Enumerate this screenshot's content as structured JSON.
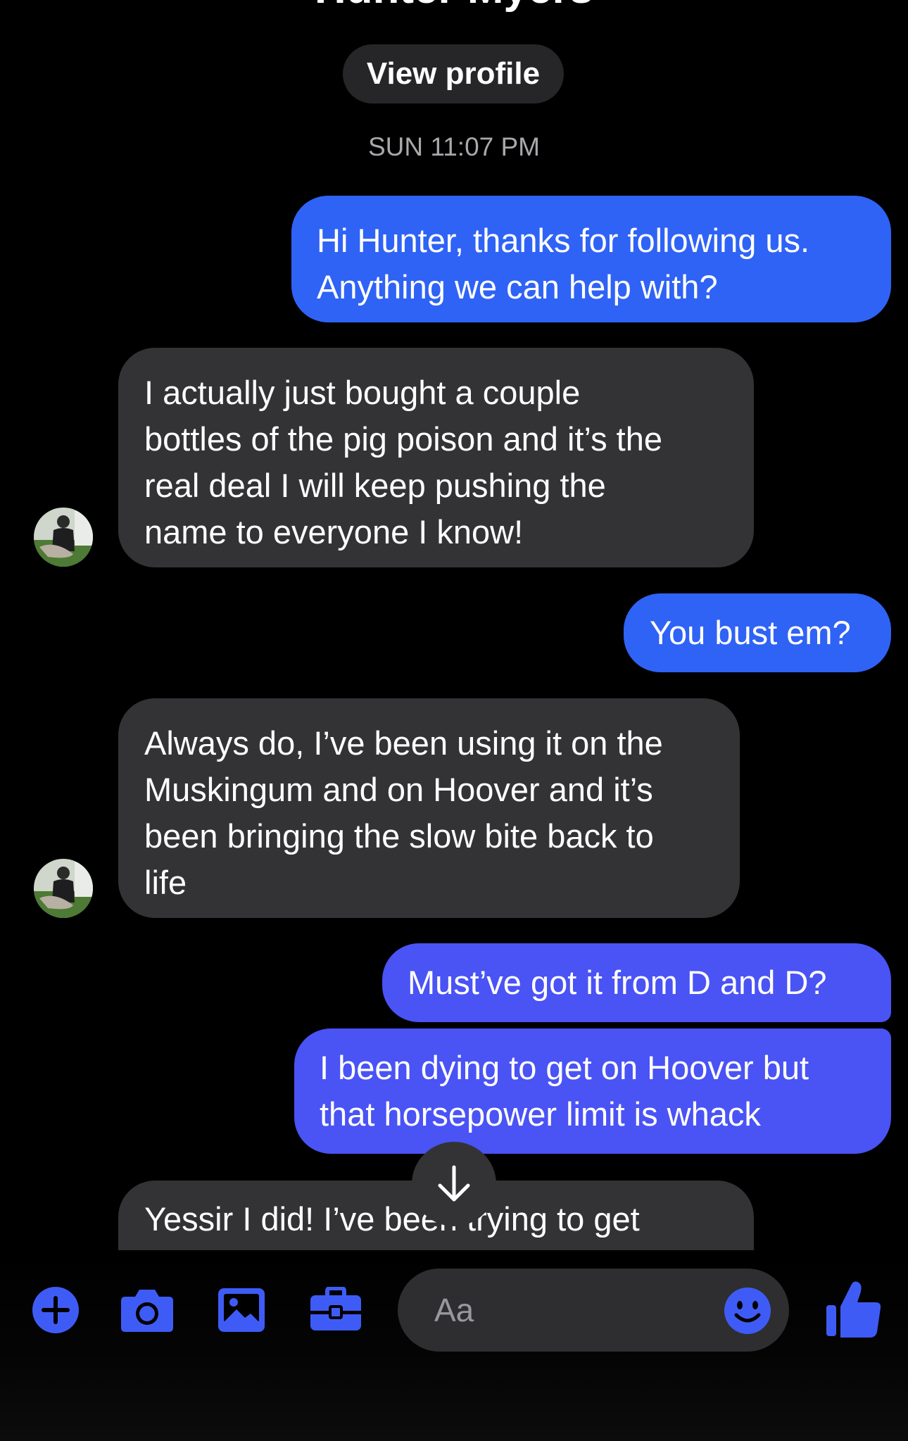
{
  "header": {
    "contact_name": "Hunter Myers",
    "view_profile_label": "View profile",
    "timestamp": "SUN 11:07 PM"
  },
  "messages": [
    {
      "direction": "outgoing",
      "text": "Hi Hunter, thanks for following us.\nAnything we can help with?"
    },
    {
      "direction": "incoming",
      "text": "I actually just bought a couple\nbottles of the pig poison and it’s the\nreal deal I will keep pushing the\nname to everyone I know!"
    },
    {
      "direction": "outgoing",
      "text": "You bust em?"
    },
    {
      "direction": "incoming",
      "text": "Always do, I’ve been using it on the\nMuskingum and on Hoover and it’s\nbeen bringing the slow bite back to\nlife"
    },
    {
      "direction": "outgoing",
      "text": "Must’ve got it from D and D?"
    },
    {
      "direction": "outgoing",
      "text": "I been dying to get on Hoover but\nthat horsepower limit is whack"
    },
    {
      "direction": "incoming",
      "text": "Yessir I did! I’ve been trying to get"
    }
  ],
  "composer": {
    "placeholder": "Aa",
    "icons": [
      "plus-icon",
      "camera-icon",
      "photo-icon",
      "toolbox-icon",
      "emoji-icon",
      "thumbs-up-icon"
    ]
  },
  "colors": {
    "accent": "#2f63f5",
    "accent_alt": "#4a53f4",
    "incoming_bubble": "#333336",
    "background": "#000000",
    "icon_blue": "#3e5cf5"
  }
}
